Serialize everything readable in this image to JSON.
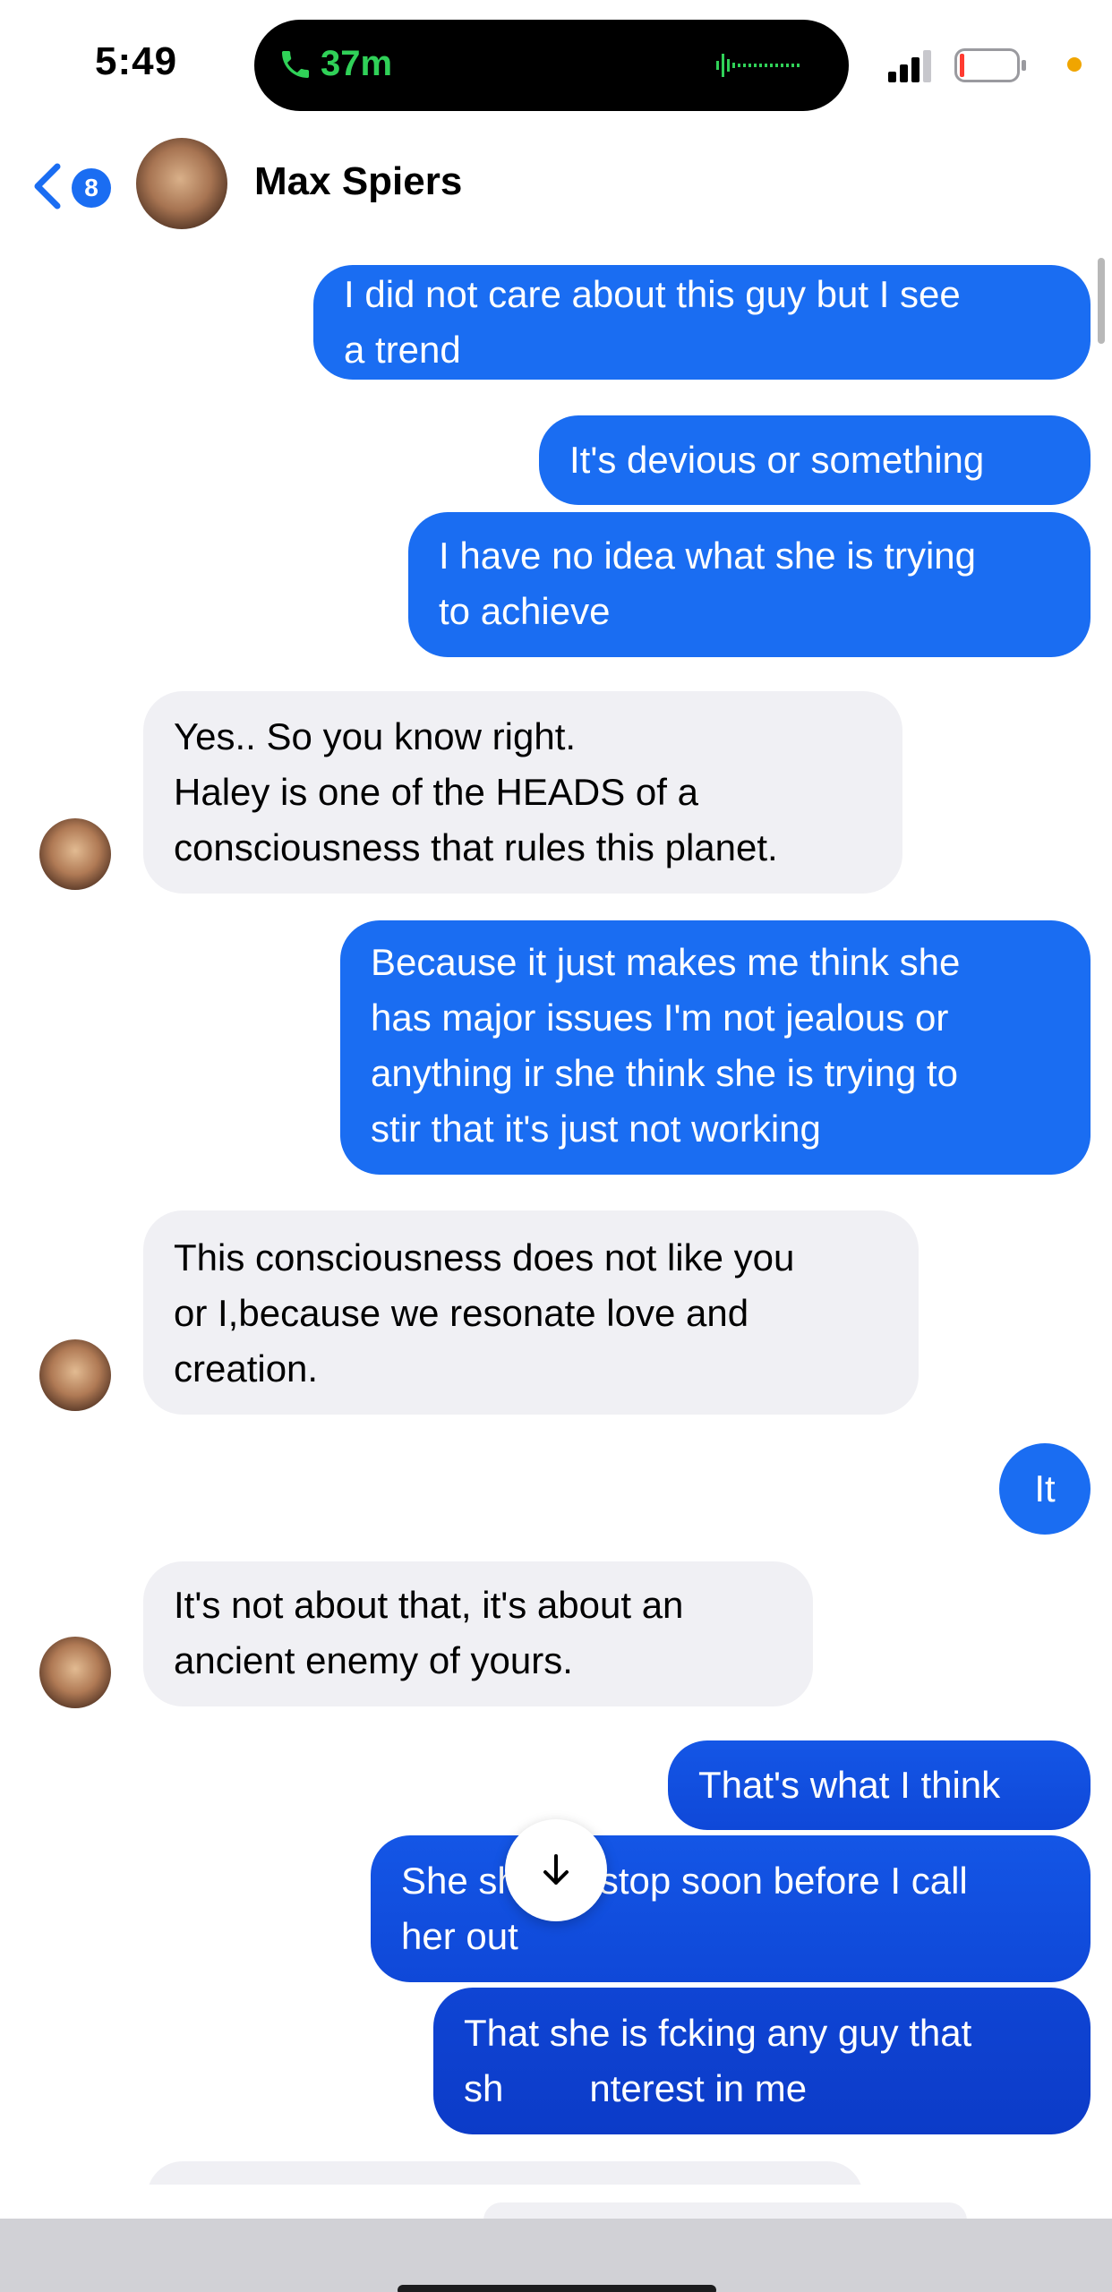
{
  "status_bar": {
    "time": "5:49",
    "call_duration": "37m",
    "call_color": "#30d158"
  },
  "header": {
    "unread_count": "8",
    "contact_name": "Max Spiers",
    "accent": "#1a6df2"
  },
  "messages": [
    {
      "from": "me",
      "lines": [
        "I did not care about this guy but I see",
        "a trend"
      ]
    },
    {
      "from": "me",
      "lines": [
        "It's devious or something"
      ]
    },
    {
      "from": "me",
      "lines": [
        "I have no idea what she is trying",
        "to achieve"
      ]
    },
    {
      "from": "them",
      "lines": [
        "Yes.. So you know right.",
        "Haley is one of the HEADS of a",
        "consciousness that rules this planet."
      ]
    },
    {
      "from": "me",
      "lines": [
        "Because it just makes me think she",
        "has major issues I'm not jealous or",
        "anything ir she think she is trying to",
        "stir that it's just not working"
      ]
    },
    {
      "from": "them",
      "lines": [
        "This consciousness does not like you",
        "or I,because we resonate love and",
        "creation."
      ]
    },
    {
      "from": "me",
      "lines": [
        "It"
      ]
    },
    {
      "from": "them",
      "lines": [
        "It's not about that, it's about an",
        "ancient enemy of yours."
      ]
    },
    {
      "from": "me",
      "lines": [
        "That's what I think"
      ]
    },
    {
      "from": "me",
      "lines": [
        "She should stop soon before I call",
        "her out"
      ]
    },
    {
      "from": "me",
      "lines": [
        "That she is fcking any guy that",
        "sh",
        "nterest in me"
      ]
    }
  ],
  "icons": {
    "back": "chevron-left-icon",
    "phone": "phone-icon",
    "scroll_down": "arrow-down-icon"
  }
}
